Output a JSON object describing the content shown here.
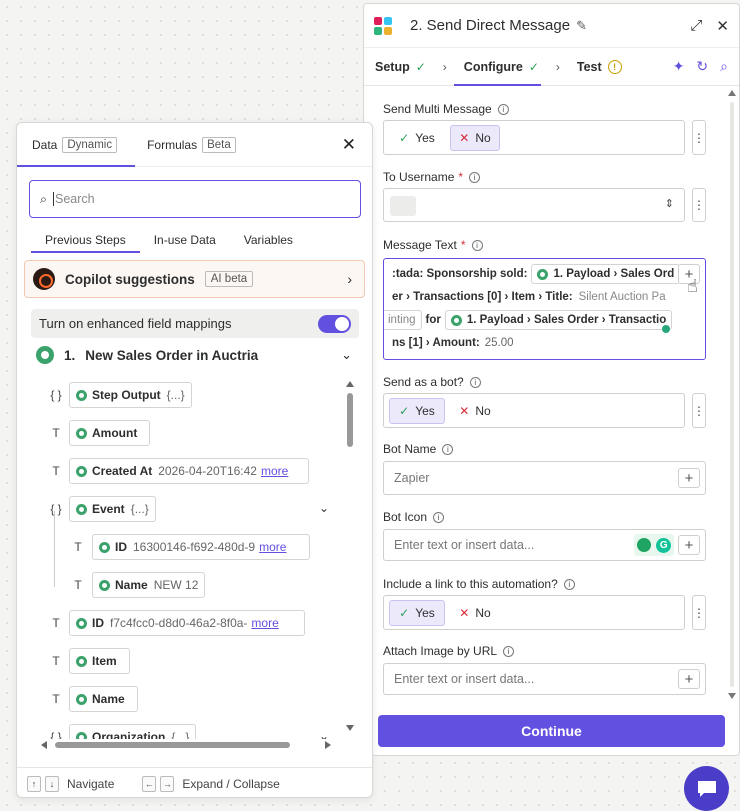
{
  "panel": {
    "title": "2. Send Direct Message",
    "tabs": [
      {
        "label": "Setup"
      },
      {
        "label": "Configure"
      },
      {
        "label": "Test"
      }
    ]
  },
  "fields": {
    "multi_message": {
      "label": "Send Multi Message",
      "yes": "Yes",
      "no": "No",
      "selected": "No"
    },
    "to_username": {
      "label": "To Username",
      "required": "*"
    },
    "message_text": {
      "label": "Message Text",
      "required": "*",
      "line1_text": ":tada: Sponsorship sold:",
      "line1_pill": "1. Payload › Sales Ord",
      "line2_text": "er › Transactions [0] › Item › Title:",
      "line2_value": "Silent Auction Pa",
      "line3_pill_light": "inting",
      "line3_text": "for",
      "line3_pill": "1. Payload › Sales Order › Transactio",
      "line4_text": "ns [1] › Amount:",
      "line4_value": "25.00"
    },
    "send_as_bot": {
      "label": "Send as a bot?",
      "yes": "Yes",
      "no": "No",
      "selected": "Yes"
    },
    "bot_name": {
      "label": "Bot Name",
      "placeholder": "Zapier"
    },
    "bot_icon": {
      "label": "Bot Icon",
      "placeholder": "Enter text or insert data..."
    },
    "include_link": {
      "label": "Include a link to this automation?",
      "yes": "Yes",
      "no": "No",
      "selected": "Yes"
    },
    "attach_image": {
      "label": "Attach Image by URL",
      "placeholder": "Enter text or insert data..."
    }
  },
  "continue_label": "Continue",
  "data_panel": {
    "tabs": [
      {
        "label": "Data",
        "badge": "Dynamic"
      },
      {
        "label": "Formulas",
        "badge": "Beta"
      }
    ],
    "search_placeholder": "Search",
    "sub_tabs": [
      "Previous Steps",
      "In-use Data",
      "Variables"
    ],
    "copilot": {
      "title": "Copilot suggestions",
      "badge": "AI beta"
    },
    "enhanced_label": "Turn on enhanced field mappings",
    "step": {
      "number": "1.",
      "title": "New Sales Order in Auctria"
    },
    "tree": [
      {
        "icon": "{ }",
        "name": "Step Output",
        "value": "{...}",
        "more": ""
      },
      {
        "icon": "T",
        "name": "Amount",
        "value": "",
        "more": ""
      },
      {
        "icon": "T",
        "name": "Created At",
        "value": "2026-04-20T16:42",
        "more": "more"
      },
      {
        "icon": "{ }",
        "name": "Event",
        "value": "{...}",
        "more": ""
      },
      {
        "icon": "T",
        "name": "ID",
        "value": "16300146-f692-480d-9",
        "more": "more"
      },
      {
        "icon": "T",
        "name": "Name",
        "value": "NEW 12",
        "more": ""
      },
      {
        "icon": "T",
        "name": "ID",
        "value": "f7c4fcc0-d8d0-46a2-8f0a-",
        "more": "more"
      },
      {
        "icon": "T",
        "name": "Item",
        "value": "",
        "more": ""
      },
      {
        "icon": "T",
        "name": "Name",
        "value": "",
        "more": ""
      },
      {
        "icon": "{ }",
        "name": "Organization",
        "value": "{...}",
        "more": ""
      }
    ],
    "footer": {
      "navigate": "Navigate",
      "expand": "Expand / Collapse"
    }
  }
}
